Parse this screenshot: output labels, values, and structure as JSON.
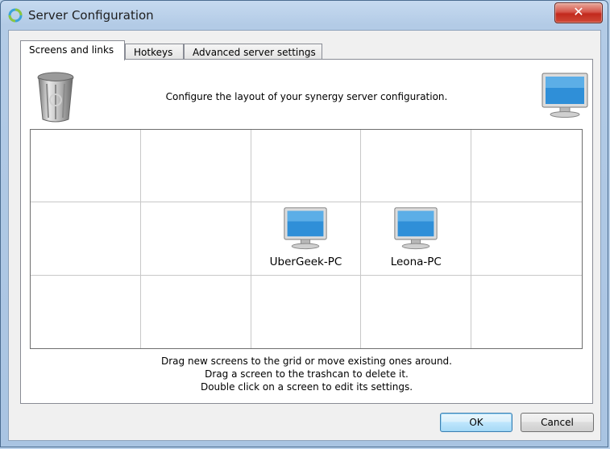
{
  "window": {
    "title": "Server Configuration",
    "close_symbol": "✕"
  },
  "tabs": [
    {
      "label": "Screens and links",
      "active": true
    },
    {
      "label": "Hotkeys",
      "active": false
    },
    {
      "label": "Advanced server settings",
      "active": false
    }
  ],
  "panel": {
    "heading": "Configure the layout of your synergy server configuration.",
    "trash_icon": "trashcan-icon",
    "new_screen_icon": "monitor-icon"
  },
  "grid": {
    "columns": 5,
    "rows": 3,
    "screens": [
      {
        "name": "UberGeek-PC",
        "row": 1,
        "col": 2
      },
      {
        "name": "Leona-PC",
        "row": 1,
        "col": 3
      }
    ]
  },
  "instructions": {
    "line1": "Drag new screens to the grid or move existing ones around.",
    "line2": "Drag a screen to the trashcan to delete it.",
    "line3": "Double click on a screen to edit its settings."
  },
  "buttons": {
    "ok": "OK",
    "cancel": "Cancel"
  },
  "colors": {
    "accent": "#3c7fb1",
    "close": "#c2291d",
    "monitor_screen": "#2f8fd8"
  }
}
